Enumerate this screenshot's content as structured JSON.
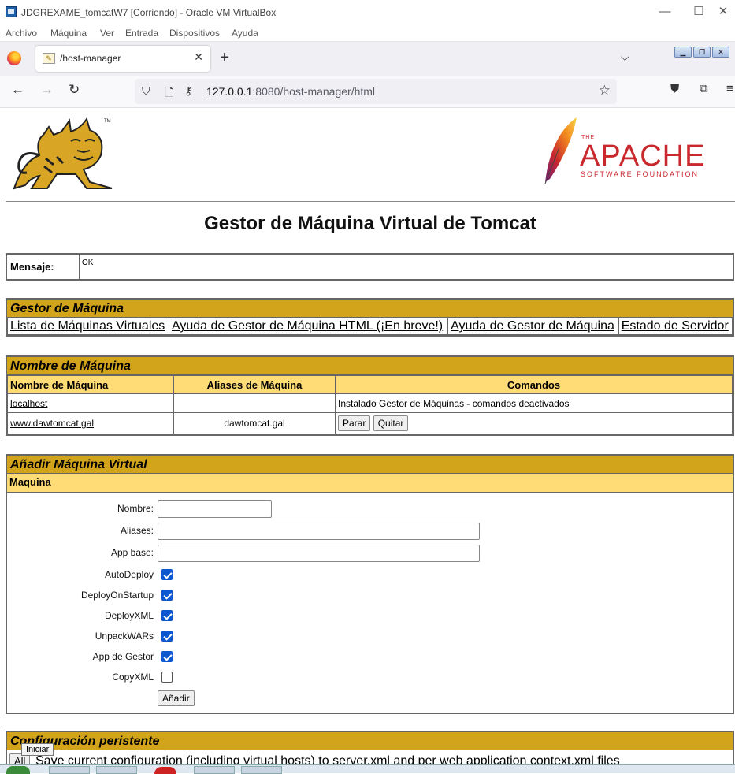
{
  "vbox": {
    "title": "JDGREXAME_tomcatW7 [Corriendo] - Oracle VM VirtualBox",
    "menu": [
      "Archivo",
      "Máquina",
      "Ver",
      "Entrada",
      "Dispositivos",
      "Ayuda"
    ]
  },
  "browser": {
    "tab_title": "/host-manager",
    "url_host": "127.0.0.1",
    "url_rest": ":8080/host-manager/html"
  },
  "page": {
    "apache_the": "THE",
    "apache_word": "APACHE",
    "apache_sub": "SOFTWARE FOUNDATION",
    "title": "Gestor de Máquina Virtual de Tomcat",
    "message": {
      "label": "Mensaje:",
      "value": "OK"
    },
    "gestor": {
      "title": "Gestor de Máquina",
      "links": [
        "Lista de Máquinas Virtuales",
        "Ayuda de Gestor de Máquina HTML (¡En breve!)",
        "Ayuda de Gestor de Máquina",
        "Estado de Servidor"
      ]
    },
    "hosts": {
      "title": "Nombre de Máquina",
      "columns": [
        "Nombre de Máquina",
        "Aliases de Máquina",
        "Comandos"
      ],
      "rows": [
        {
          "name": "localhost",
          "aliases": "",
          "commands": "Instalado Gestor de Máquinas - comandos deactivados"
        },
        {
          "name": "www.dawtomcat.gal",
          "aliases": "dawtomcat.gal",
          "btn_start": "Parar",
          "btn_remove": "Quitar"
        }
      ]
    },
    "add": {
      "title": "Añadir Máquina Virtual",
      "subtitle": "Maquina",
      "fields": {
        "name": "Nombre:",
        "aliases": "Aliases:",
        "appbase": "App base:"
      },
      "checks": [
        {
          "label": "AutoDeploy",
          "checked": true
        },
        {
          "label": "DeployOnStartup",
          "checked": true
        },
        {
          "label": "DeployXML",
          "checked": true
        },
        {
          "label": "UnpackWARs",
          "checked": true
        },
        {
          "label": "App de Gestor",
          "checked": true
        },
        {
          "label": "CopyXML",
          "checked": false
        }
      ],
      "submit": "Añadir"
    },
    "persist": {
      "title": "Configuración peristente",
      "button": "All",
      "text": "Save current configuration (including virtual hosts) to server.xml and per web application context.xml files"
    }
  },
  "taskbar": {
    "tooltip": "Iniciar"
  }
}
